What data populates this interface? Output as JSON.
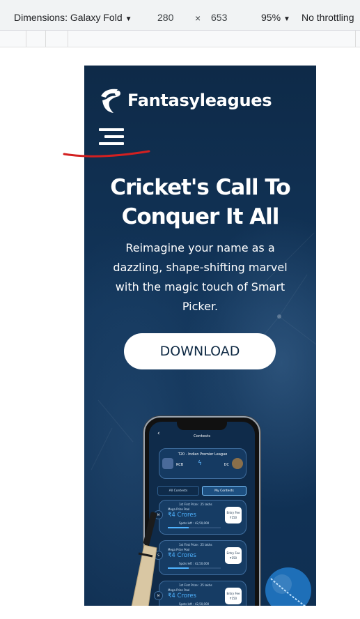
{
  "devtools": {
    "dimensions_label": "Dimensions: Galaxy Fold",
    "width": "280",
    "times": "×",
    "height": "653",
    "zoom": "95%",
    "throttling": "No throttling"
  },
  "site": {
    "brand": "Fantasyleagues",
    "hero_title_line1": "Cricket's Call To",
    "hero_title_line2": "Conquer It All",
    "hero_sub_lines": [
      "Reimagine your name as a",
      "dazzling, shape-shifting marvel",
      "with the magic touch of Smart",
      "Picker."
    ],
    "download_label": "DOWNLOAD"
  },
  "phone_screen": {
    "back": "‹",
    "title": "Contests",
    "league": "T20 - Indian Premier League",
    "team1": "RCB",
    "team2": "DC",
    "tab_all": "All Contests",
    "tab_my": "My Contests",
    "contests": [
      {
        "first": "1st First Prize : 25 lakhs",
        "pool": "Mega Prize Pool",
        "prize": "₹4 Crores",
        "spots": "Spots left : 42,50,000",
        "fee_label": "Entry Fee",
        "fee": "₹150",
        "badge": "M"
      },
      {
        "first": "1st First Prize : 25 lakhs",
        "pool": "Mega Prize Pool",
        "prize": "₹4 Crores",
        "spots": "Spots left : 42,50,000",
        "fee_label": "Entry Fee",
        "fee": "₹150",
        "badge": "S"
      },
      {
        "first": "1st First Prize : 25 lakhs",
        "pool": "Mega Prize Pool",
        "prize": "₹4 Crores",
        "spots": "Spots left : 42,50,000",
        "fee_label": "Entry Fee",
        "fee": "₹150",
        "badge": "M"
      }
    ]
  },
  "colors": {
    "background": "#12355a",
    "accent": "#4fb3ff",
    "annotation": "#d32020"
  }
}
